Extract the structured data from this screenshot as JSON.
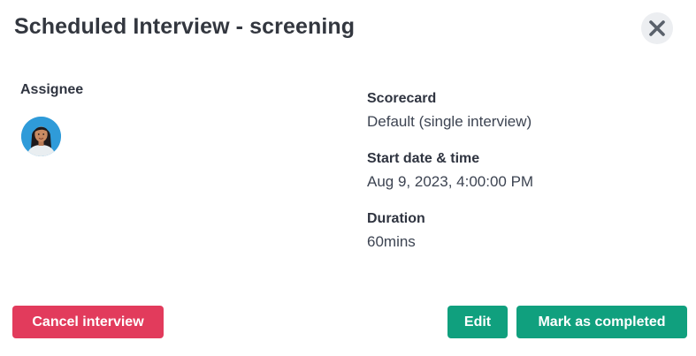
{
  "modal": {
    "title": "Scheduled Interview - screening",
    "close_icon": "close-icon"
  },
  "assignee": {
    "label": "Assignee",
    "avatar_icon": "user-avatar-icon"
  },
  "details": {
    "scorecard_label": "Scorecard",
    "scorecard_value": "Default (single interview)",
    "start_label": "Start date & time",
    "start_value": "Aug 9, 2023, 4:00:00 PM",
    "duration_label": "Duration",
    "duration_value": "60mins"
  },
  "actions": {
    "cancel_label": "Cancel interview",
    "edit_label": "Edit",
    "complete_label": "Mark as completed"
  },
  "colors": {
    "danger": "#e23b5c",
    "primary": "#10a07e",
    "close_bg": "#eceef1",
    "avatar_bg": "#2f9bd9"
  }
}
